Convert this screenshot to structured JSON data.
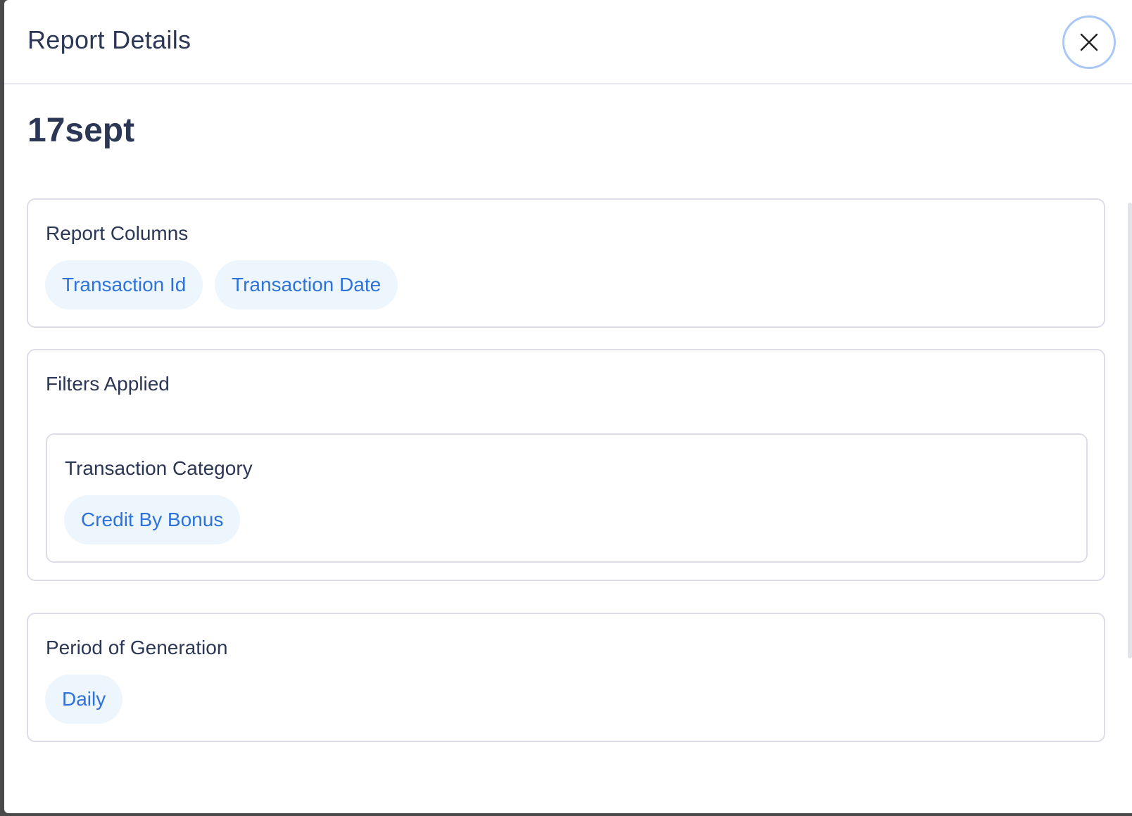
{
  "modal": {
    "title": "Report Details",
    "close_icon": "close-icon"
  },
  "report": {
    "name": "17sept"
  },
  "report_columns": {
    "label": "Report Columns",
    "chips": [
      "Transaction Id",
      "Transaction Date"
    ]
  },
  "filters": {
    "label": "Filters Applied",
    "items": [
      {
        "label": "Transaction Category",
        "chips": [
          "Credit By Bonus"
        ]
      }
    ]
  },
  "period": {
    "label": "Period of Generation",
    "chips": [
      "Daily"
    ]
  },
  "colors": {
    "text": "#2c3755",
    "chip_bg": "#edf6fd",
    "chip_text": "#2f73d9",
    "close_ring": "#a9c8f5"
  }
}
